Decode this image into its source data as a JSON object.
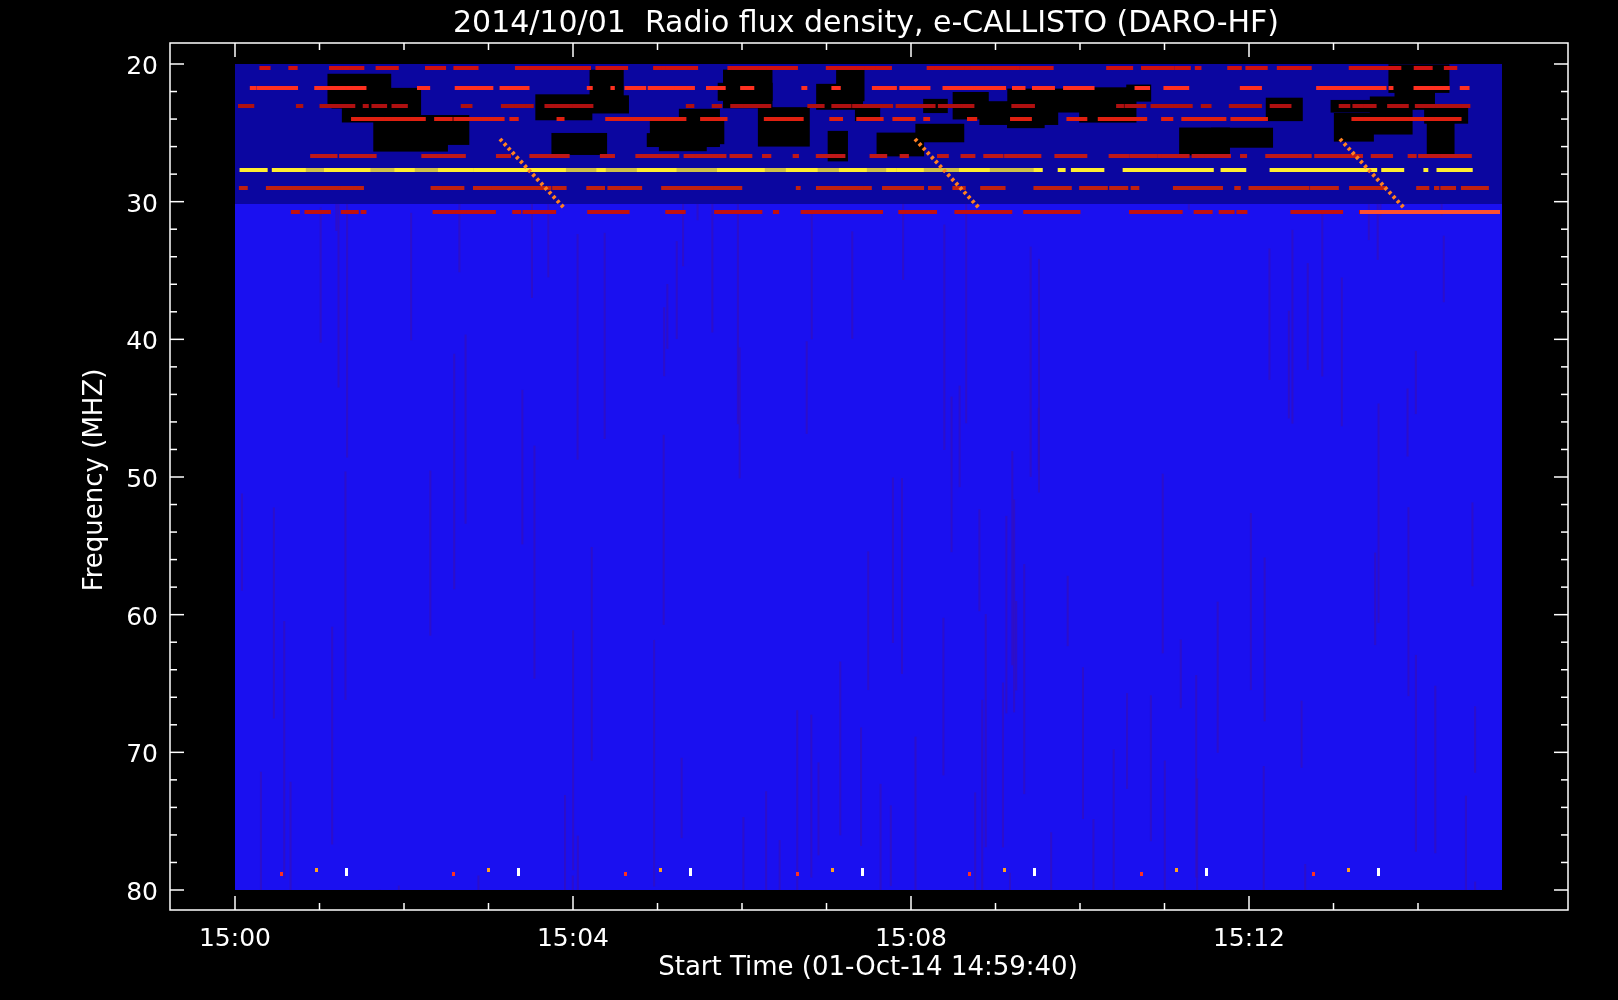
{
  "plot": {
    "title": "2014/10/01  Radio flux density, e-CALLISTO (DARO-HF)",
    "ylabel": "Frequency (MHZ)",
    "xlabel": "Start Time (01-Oct-14 14:59:40)",
    "yticks": [
      "20",
      "30",
      "40",
      "50",
      "60",
      "70",
      "80"
    ],
    "xticks": [
      "15:00",
      "15:04",
      "15:08",
      "15:12"
    ]
  }
}
